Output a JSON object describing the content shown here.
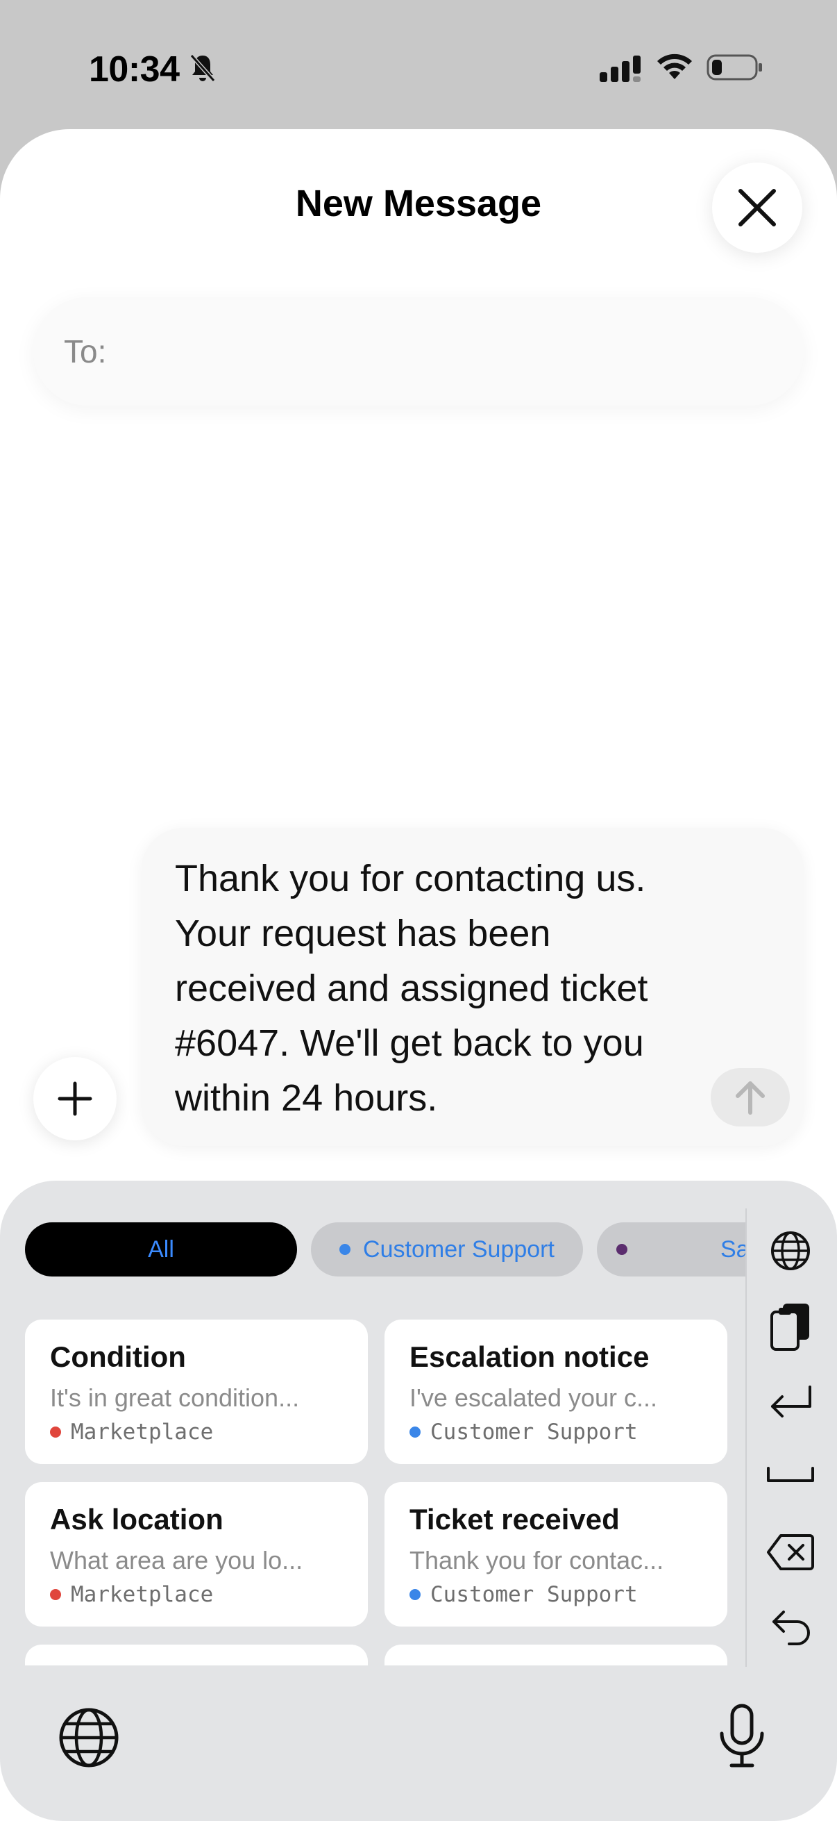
{
  "status": {
    "time": "10:34",
    "icons": [
      "bell-muted-icon",
      "cellular-signal-icon",
      "wifi-icon",
      "battery-low-icon"
    ]
  },
  "sheet": {
    "title": "New Message",
    "close_icon": "close-icon"
  },
  "to_field": {
    "label": "To:",
    "value": ""
  },
  "composer": {
    "text": "Thank you for contacting us. Your request has been received and assigned ticket #6047. We'll get back to you within 24 hours.",
    "add_icon": "plus-icon",
    "send_icon": "arrow-up-icon"
  },
  "filters": {
    "chips": [
      {
        "label": "All",
        "selected": true
      },
      {
        "label": "Customer Support",
        "dot_color": "#3a86e8"
      },
      {
        "label": "Sal",
        "dot_color": "#5b2d6e"
      }
    ]
  },
  "templates": [
    {
      "title": "Condition",
      "preview": "It's in great condition...",
      "tag": "Marketplace",
      "tag_color": "#e0463c"
    },
    {
      "title": "Escalation notice",
      "preview": "I've escalated your c...",
      "tag": "Customer Support",
      "tag_color": "#3a86e8"
    },
    {
      "title": "Ask location",
      "preview": "What area are you lo...",
      "tag": "Marketplace",
      "tag_color": "#e0463c"
    },
    {
      "title": "Ticket received",
      "preview": "Thank you for contac...",
      "tag": "Customer Support",
      "tag_color": "#3a86e8"
    }
  ],
  "side_actions": [
    "globe-icon",
    "paste-icon",
    "return-icon",
    "space-icon",
    "delete-icon",
    "undo-icon"
  ],
  "keyboard_bottom": {
    "left_icon": "globe-icon",
    "right_icon": "microphone-icon"
  },
  "colors": {
    "accent_blue": "#3b8bff",
    "marketplace_red": "#e0463c",
    "support_blue": "#3a86e8",
    "sales_purple": "#5b2d6e"
  }
}
